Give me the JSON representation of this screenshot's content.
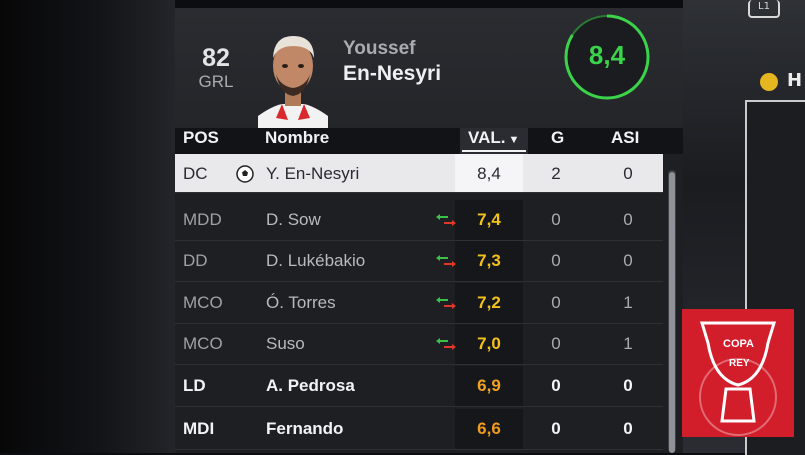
{
  "player": {
    "overall": "82",
    "overall_position": "GRL",
    "first_name": "Youssef",
    "last_name": "En-Nesyri",
    "match_rating": "8,4"
  },
  "table": {
    "headers": {
      "pos": "POS",
      "name": "Nombre",
      "val": "VAL.",
      "goals": "G",
      "assists": "ASI"
    },
    "rows": [
      {
        "pos": "DC",
        "name": "Y. En-Nesyri",
        "val": "8,4",
        "g": "2",
        "asi": "0",
        "selected": true,
        "icon": "football-icon",
        "val_color": "#2a2b30"
      },
      {
        "pos": "MDD",
        "name": "D. Sow",
        "val": "7,4",
        "g": "0",
        "asi": "0",
        "icon": "substitution-icon",
        "val_color": "#f2c21b"
      },
      {
        "pos": "DD",
        "name": "D. Lukébakio",
        "val": "7,3",
        "g": "0",
        "asi": "0",
        "icon": "substitution-icon",
        "val_color": "#f2c21b"
      },
      {
        "pos": "MCO",
        "name": "Ó. Torres",
        "val": "7,2",
        "g": "0",
        "asi": "1",
        "icon": "substitution-icon",
        "val_color": "#f2c21b"
      },
      {
        "pos": "MCO",
        "name": "Suso",
        "val": "7,0",
        "g": "0",
        "asi": "1",
        "icon": "substitution-icon",
        "val_color": "#f2c21b"
      },
      {
        "pos": "LD",
        "name": "A. Pedrosa",
        "val": "6,9",
        "g": "0",
        "asi": "0",
        "val_color": "#f0a320"
      },
      {
        "pos": "MDI",
        "name": "Fernando",
        "val": "6,6",
        "g": "0",
        "asi": "0",
        "val_color": "#ef9a22"
      }
    ]
  },
  "right_panel": {
    "badge": "L1",
    "text": "H"
  },
  "overlay": {
    "line1": "COPA",
    "line2": "REY"
  },
  "colors": {
    "rating_green": "#3bd34a",
    "sub_in": "#3bc04a",
    "sub_out": "#e0362c",
    "copa_red": "#d21d2a"
  }
}
